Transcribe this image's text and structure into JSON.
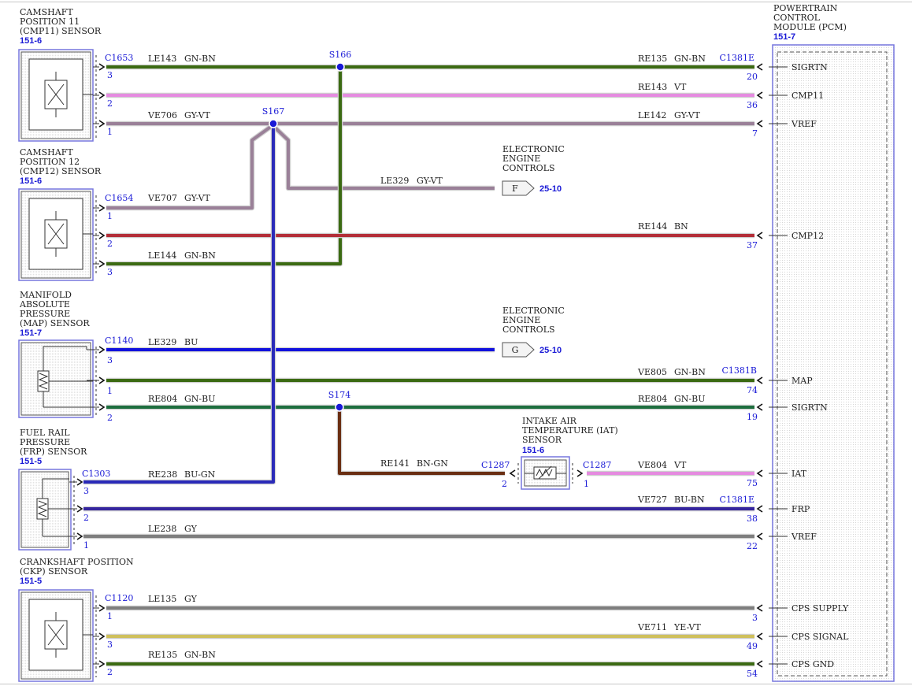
{
  "colors": {
    "GN-BN": "#3b6a12",
    "VT": "#e58be0",
    "GY-VT": "#9a8098",
    "BN": "#b32e38",
    "BU": "#1111dd",
    "GN-BU": "#1e6e3e",
    "BN-GN": "#6a2e12",
    "BU-GN": "#2a2ab8",
    "BU-BN": "#35259e",
    "GY": "#7e7e7e",
    "YE-VT": "#cfc05c",
    "link": "#1a1ad6",
    "box": "#7777dd"
  },
  "pcm": {
    "title": [
      "POWERTRAIN",
      "CONTROL",
      "MODULE (PCM)"
    ],
    "ref": "151-7",
    "pins": [
      {
        "label": "SIGRTN",
        "pin": "20"
      },
      {
        "label": "CMP11",
        "pin": "36"
      },
      {
        "label": "VREF",
        "pin": "7"
      },
      {
        "label": "CMP12",
        "pin": "37"
      },
      {
        "label": "MAP",
        "pin": "74"
      },
      {
        "label": "SIGRTN",
        "pin": "19"
      },
      {
        "label": "IAT",
        "pin": "75"
      },
      {
        "label": "FRP",
        "pin": "38"
      },
      {
        "label": "VREF",
        "pin": "22"
      },
      {
        "label": "CPS SUPPLY",
        "pin": "3"
      },
      {
        "label": "CPS SIGNAL",
        "pin": "49"
      },
      {
        "label": "CPS GND",
        "pin": "54"
      }
    ],
    "connectors": [
      "C1381E",
      "C1381B",
      "C1381E"
    ]
  },
  "components": [
    {
      "title": [
        "CAMSHAFT",
        "POSITION 11",
        "(CMP11) SENSOR"
      ],
      "ref": "151-6",
      "connector": "C1653",
      "pins": [
        "3",
        "2",
        "1"
      ]
    },
    {
      "title": [
        "CAMSHAFT",
        "POSITION 12",
        "(CMP12) SENSOR"
      ],
      "ref": "151-6",
      "connector": "C1654",
      "pins": [
        "1",
        "2",
        "3"
      ]
    },
    {
      "title": [
        "MANIFOLD",
        "ABSOLUTE",
        "PRESSURE",
        "(MAP) SENSOR"
      ],
      "ref": "151-7",
      "connector": "C1140",
      "pins": [
        "3",
        "1",
        "2"
      ]
    },
    {
      "title": [
        "FUEL RAIL",
        "PRESSURE",
        "(FRP) SENSOR"
      ],
      "ref": "151-5",
      "connector": "C1303",
      "pins": [
        "3",
        "2",
        "1"
      ]
    },
    {
      "title": [
        "CRANKSHAFT POSITION",
        "(CKP) SENSOR"
      ],
      "ref": "151-5",
      "connector": "C1120",
      "pins": [
        "1",
        "3",
        "2"
      ]
    }
  ],
  "iat": {
    "title": [
      "INTAKE AIR",
      "TEMPERATURE (IAT)",
      "SENSOR"
    ],
    "ref": "151-6",
    "connector_left": "C1287",
    "connector_right": "C1287",
    "pin_left": "2",
    "pin_right": "1"
  },
  "splices": [
    "S166",
    "S167",
    "S174"
  ],
  "offpage": [
    {
      "title": [
        "ELECTRONIC",
        "ENGINE",
        "CONTROLS"
      ],
      "letter": "F",
      "ref": "25-10"
    },
    {
      "title": [
        "ELECTRONIC",
        "ENGINE",
        "CONTROLS"
      ],
      "letter": "G",
      "ref": "25-10"
    }
  ],
  "wires": [
    {
      "id": "LE143",
      "color": "GN-BN"
    },
    {
      "id": "RE135",
      "color": "GN-BN"
    },
    {
      "id": "RE143",
      "color": "VT"
    },
    {
      "id": "VE706",
      "color": "GY-VT"
    },
    {
      "id": "LE142",
      "color": "GY-VT"
    },
    {
      "id": "LE329",
      "color": "GY-VT"
    },
    {
      "id": "VE707",
      "color": "GY-VT"
    },
    {
      "id": "RE144",
      "color": "BN"
    },
    {
      "id": "LE144",
      "color": "GN-BN"
    },
    {
      "id": "LE329",
      "color": "BU"
    },
    {
      "id": "VE805",
      "color": "GN-BN"
    },
    {
      "id": "RE804",
      "color": "GN-BU"
    },
    {
      "id": "RE804",
      "color": "GN-BU"
    },
    {
      "id": "RE141",
      "color": "BN-GN"
    },
    {
      "id": "VE804",
      "color": "VT"
    },
    {
      "id": "RE238",
      "color": "BU-GN"
    },
    {
      "id": "VE727",
      "color": "BU-BN"
    },
    {
      "id": "LE238",
      "color": "GY"
    },
    {
      "id": "LE135",
      "color": "GY"
    },
    {
      "id": "VE711",
      "color": "YE-VT"
    },
    {
      "id": "RE135",
      "color": "GN-BN"
    }
  ]
}
